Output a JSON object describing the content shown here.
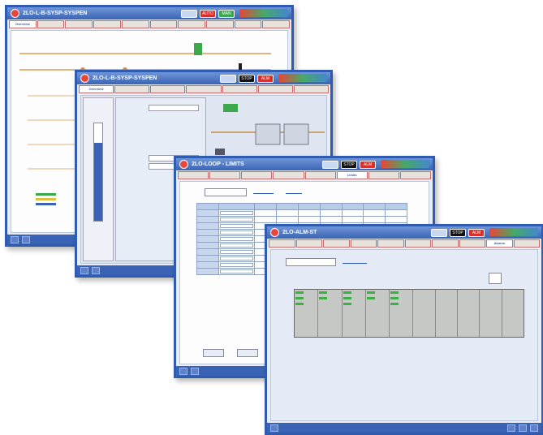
{
  "windows": [
    {
      "title": "2LO-L-B-SYSP-SYSPEN",
      "controls": [
        "AUTO",
        "MAN"
      ],
      "active_tab": "Overview"
    },
    {
      "title": "2LO-L-B-SYSP-SYSPEN",
      "controls": [
        "STOP",
        "ALM"
      ],
      "active_tab": "Overview"
    },
    {
      "title": "2LO-LOOP - LIMITS",
      "controls": [
        "STOP",
        "ALM"
      ],
      "active_tab": "Limits"
    },
    {
      "title": "2LO-ALM-ST",
      "controls": [
        "STOP",
        "ALM"
      ],
      "active_tab": "Alarms"
    }
  ],
  "colors": {
    "frame": "#2f5cb0",
    "title_bar": "#3a63b5",
    "accent_red": "#d9302b",
    "accent_green": "#3aa84b"
  }
}
